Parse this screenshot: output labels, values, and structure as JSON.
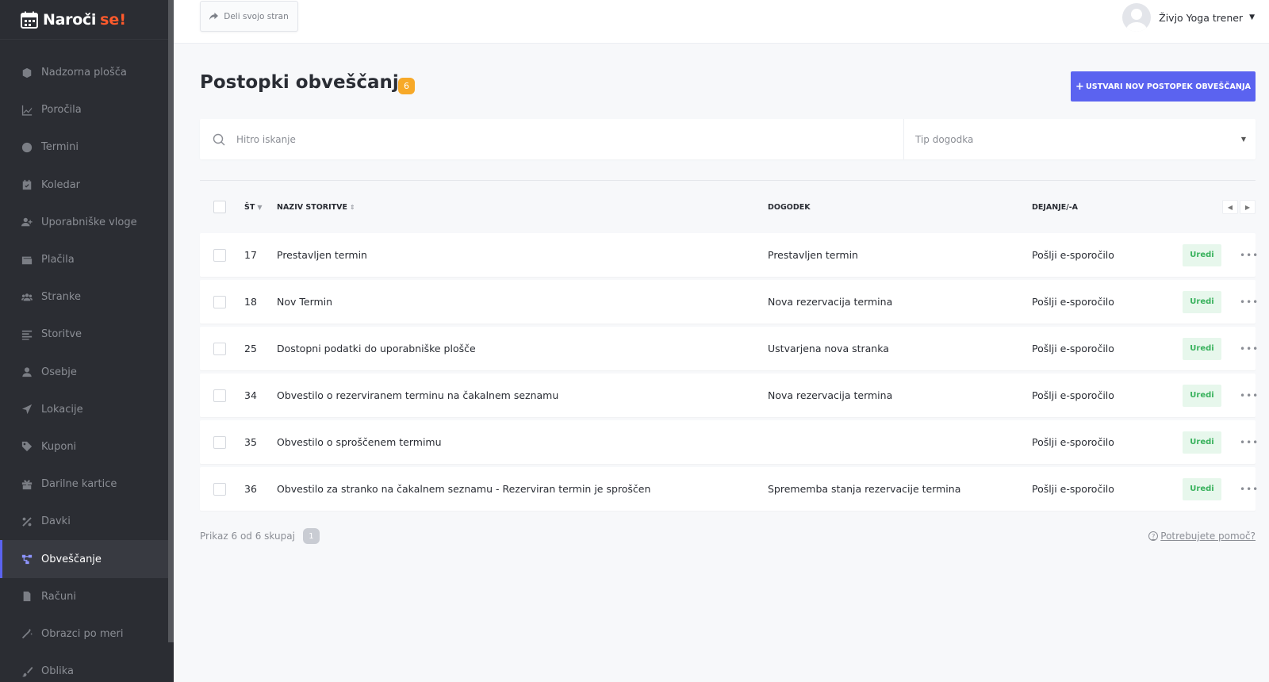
{
  "brand": {
    "name": "Naroči",
    "accent": "se!"
  },
  "sidebar": {
    "items": [
      {
        "label": "Nadzorna plošča",
        "icon": "cube-icon"
      },
      {
        "label": "Poročila",
        "icon": "chart-icon"
      },
      {
        "label": "Termini",
        "icon": "clock-icon"
      },
      {
        "label": "Koledar",
        "icon": "calendar-check-icon"
      },
      {
        "label": "Uporabniške vloge",
        "icon": "user-plus-icon"
      },
      {
        "label": "Plačila",
        "icon": "wallet-icon"
      },
      {
        "label": "Stranke",
        "icon": "users-icon"
      },
      {
        "label": "Storitve",
        "icon": "list-icon"
      },
      {
        "label": "Osebje",
        "icon": "user-icon"
      },
      {
        "label": "Lokacije",
        "icon": "location-arrow-icon"
      },
      {
        "label": "Kuponi",
        "icon": "tag-icon"
      },
      {
        "label": "Darilne kartice",
        "icon": "gift-icon"
      },
      {
        "label": "Davki",
        "icon": "percent-icon"
      },
      {
        "label": "Obveščanje",
        "icon": "workflow-icon",
        "active": true
      },
      {
        "label": "Računi",
        "icon": "invoice-icon"
      },
      {
        "label": "Obrazci po meri",
        "icon": "magic-wand-icon"
      },
      {
        "label": "Oblika",
        "icon": "brush-icon"
      }
    ]
  },
  "topbar": {
    "share_label": "Deli svojo stran",
    "user_name": "Živjo Yoga trener"
  },
  "page": {
    "title": "Postopki obveščanja",
    "count": "6",
    "create_label": "USTVARI NOV POSTOPEK OBVEŠČANJA",
    "search_placeholder": "Hitro iskanje",
    "event_type_placeholder": "Tip dogodka"
  },
  "table": {
    "headers": {
      "num": "ŠT",
      "name": "NAZIV STORITVE",
      "event": "DOGODEK",
      "action": "DEJANJE/-A"
    },
    "edit_label": "Uredi",
    "rows": [
      {
        "num": "17",
        "name": "Prestavljen termin",
        "event": "Prestavljen termin",
        "action": "Pošlji e-sporočilo"
      },
      {
        "num": "18",
        "name": "Nov Termin",
        "event": "Nova rezervacija termina",
        "action": "Pošlji e-sporočilo"
      },
      {
        "num": "25",
        "name": "Dostopni podatki do uporabniške plošče",
        "event": "Ustvarjena nova stranka",
        "action": "Pošlji e-sporočilo"
      },
      {
        "num": "34",
        "name": "Obvestilo o rezerviranem terminu na čakalnem seznamu",
        "event": "Nova rezervacija termina",
        "action": "Pošlji e-sporočilo"
      },
      {
        "num": "35",
        "name": "Obvestilo o sproščenem termimu",
        "event": "",
        "action": "Pošlji e-sporočilo"
      },
      {
        "num": "36",
        "name": "Obvestilo za stranko na čakalnem seznamu - Rezerviran termin je sproščen",
        "event": "Sprememba stanja rezervacije termina",
        "action": "Pošlji e-sporočilo"
      }
    ]
  },
  "footer": {
    "summary": "Prikaz 6 od 6 skupaj",
    "page": "1",
    "help": "Potrebujete pomoč?"
  },
  "colors": {
    "accent": "#5b63f0",
    "sidebar_bg": "#2b2d33",
    "badge": "#f7a928",
    "edit_bg": "#e7f7ec",
    "edit_text": "#39b25d",
    "brand_accent": "#ff5a2c"
  }
}
